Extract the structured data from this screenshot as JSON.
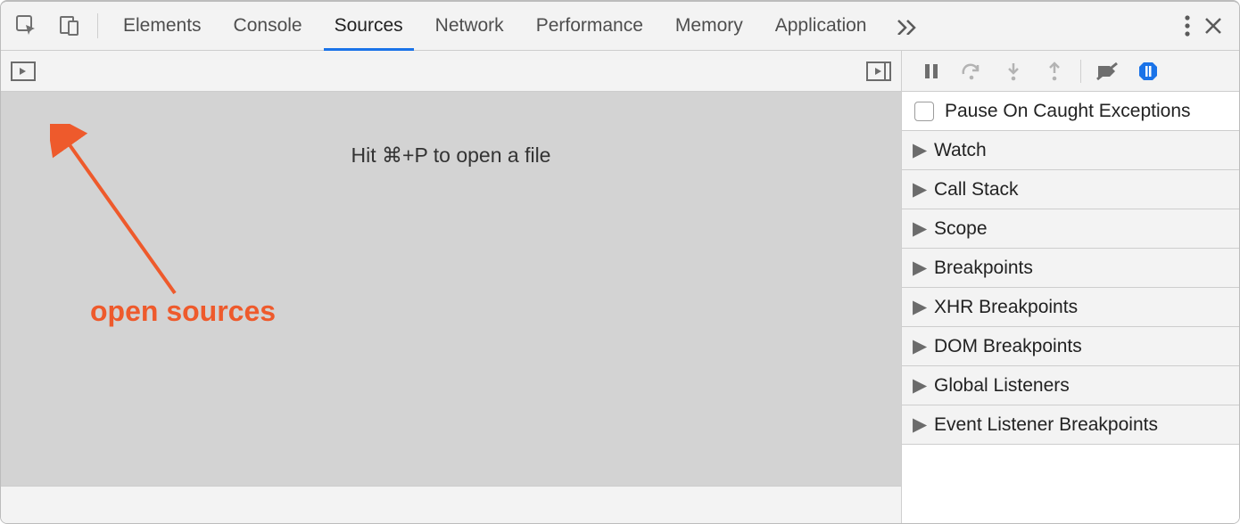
{
  "tabs": {
    "elements": "Elements",
    "console": "Console",
    "sources": "Sources",
    "network": "Network",
    "performance": "Performance",
    "memory": "Memory",
    "application": "Application"
  },
  "active_tab": "sources",
  "sources": {
    "hint": "Hit ⌘+P to open a file"
  },
  "annotation": {
    "label": "open sources"
  },
  "debugger": {
    "pause_on_caught": "Pause On Caught Exceptions",
    "panels": {
      "watch": "Watch",
      "call_stack": "Call Stack",
      "scope": "Scope",
      "breakpoints": "Breakpoints",
      "xhr_breakpoints": "XHR Breakpoints",
      "dom_breakpoints": "DOM Breakpoints",
      "global_listeners": "Global Listeners",
      "event_listener_breakpoints": "Event Listener Breakpoints"
    }
  },
  "colors": {
    "accent": "#1a73e8",
    "annotation": "#ee5a2c"
  }
}
